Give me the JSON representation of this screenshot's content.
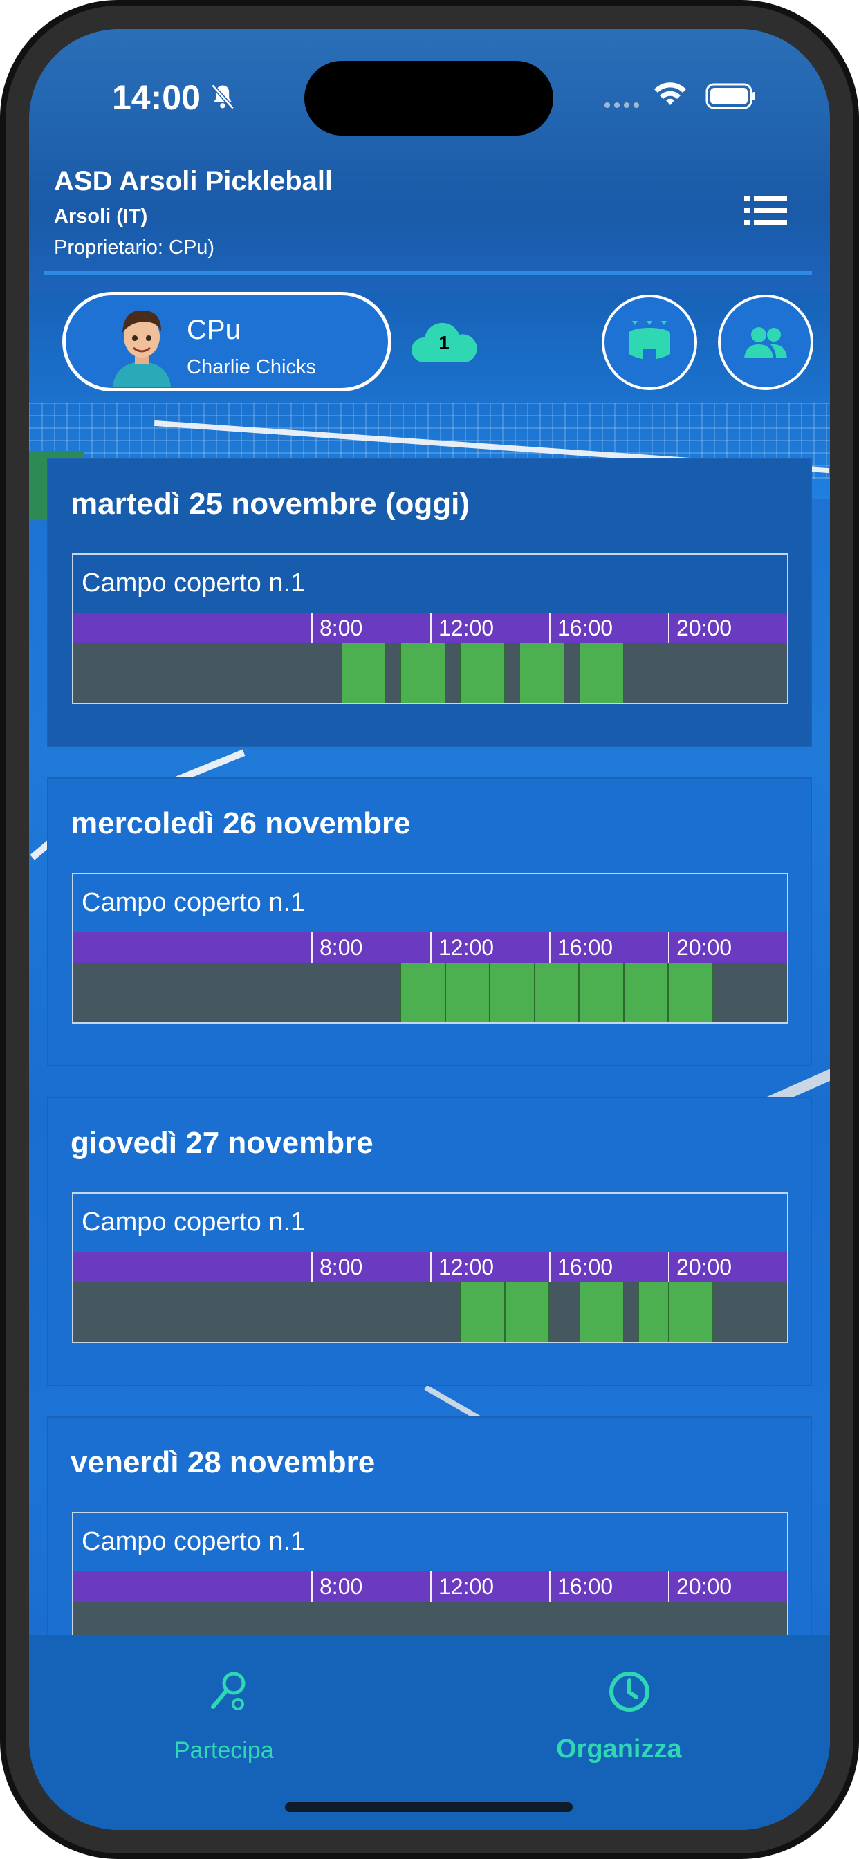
{
  "status_bar": {
    "time": "14:00",
    "icons": [
      "bell-slash-icon",
      "signal-icon",
      "wifi-icon",
      "battery-icon"
    ]
  },
  "club": {
    "name": "ASD Arsoli Pickleball",
    "city": "Arsoli (IT)",
    "owner": "Proprietario: CPu)"
  },
  "user": {
    "short_name": "CPu",
    "full_name": "Charlie Chicks"
  },
  "cloud_badge": {
    "count": "1"
  },
  "timeline_ticks": [
    "8:00",
    "12:00",
    "16:00",
    "20:00"
  ],
  "days": [
    {
      "title": "martedì 25 novembre (oggi)",
      "court": "Campo coperto n.1",
      "booked_hours": [
        9,
        11,
        13,
        15,
        17
      ]
    },
    {
      "title": "mercoledì 26 novembre",
      "court": "Campo coperto n.1",
      "booked_hours": [
        11,
        12.5,
        14,
        15.5,
        17,
        18.5,
        20
      ]
    },
    {
      "title": "giovedì 27 novembre",
      "court": "Campo coperto n.1",
      "booked_hours": [
        13,
        14.5,
        17,
        19,
        20
      ]
    },
    {
      "title": "venerdì 28 novembre",
      "court": "Campo coperto n.1",
      "booked_hours": []
    }
  ],
  "tabs": [
    {
      "label": "Partecipa",
      "icon": "racket-icon",
      "active": false
    },
    {
      "label": "Organizza",
      "icon": "clock-icon",
      "active": true
    }
  ],
  "colors": {
    "accent": "#2fd7b3",
    "timeline": "#6a3ac0",
    "slot_free": "#455860",
    "slot_booked": "#4caf50"
  }
}
